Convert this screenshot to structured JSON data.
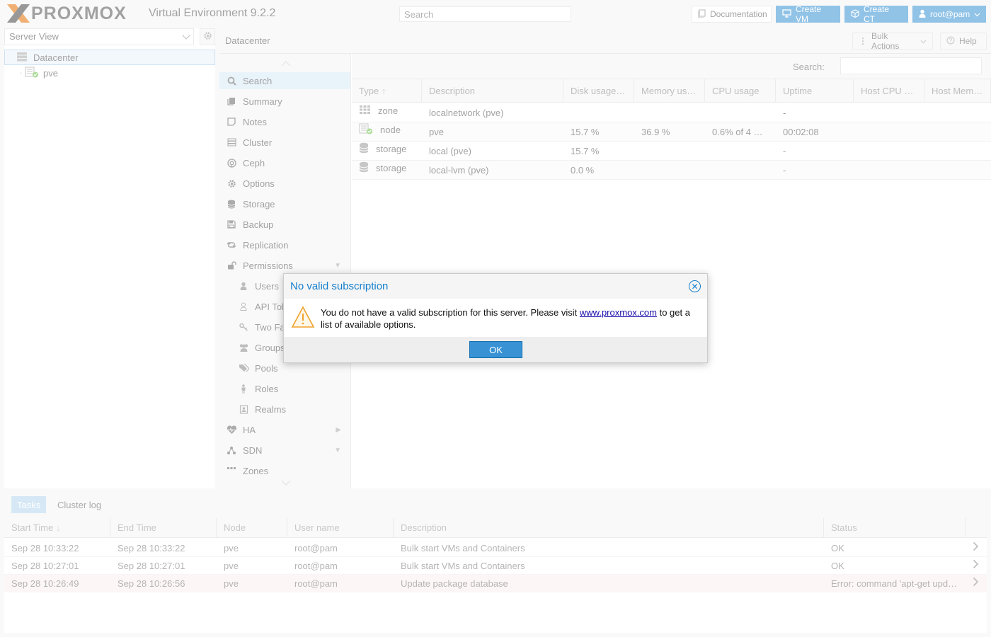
{
  "topbar": {
    "logo_text": "PROXMOX",
    "version": "Virtual Environment 9.2.2",
    "search_placeholder": "Search",
    "documentation": "Documentation",
    "create_vm": "Create VM",
    "create_ct": "Create CT",
    "user": "root@pam"
  },
  "left": {
    "view_selector": "Server View",
    "tree": [
      {
        "label": "Datacenter",
        "icon": "datacenter-icon"
      },
      {
        "label": "pve",
        "icon": "node-ok-icon"
      }
    ]
  },
  "main": {
    "title": "Datacenter",
    "bulk_actions": "Bulk Actions",
    "help": "Help",
    "nav": [
      {
        "label": "Search",
        "icon": "search-icon",
        "active": true
      },
      {
        "label": "Summary",
        "icon": "book-icon"
      },
      {
        "label": "Notes",
        "icon": "notes-icon"
      },
      {
        "label": "Cluster",
        "icon": "server-icon"
      },
      {
        "label": "Ceph",
        "icon": "ceph-icon"
      },
      {
        "label": "Options",
        "icon": "gear-icon"
      },
      {
        "label": "Storage",
        "icon": "database-icon"
      },
      {
        "label": "Backup",
        "icon": "floppy-icon"
      },
      {
        "label": "Replication",
        "icon": "retweet-icon"
      },
      {
        "label": "Permissions",
        "icon": "unlock-icon"
      },
      {
        "label": "Users",
        "icon": "user-icon"
      },
      {
        "label": "API Tok",
        "icon": "user-outline-icon"
      },
      {
        "label": "Two Fa",
        "icon": "key-icon"
      },
      {
        "label": "Groups",
        "icon": "users-icon"
      },
      {
        "label": "Pools",
        "icon": "tags-icon"
      },
      {
        "label": "Roles",
        "icon": "male-icon"
      },
      {
        "label": "Realms",
        "icon": "address-book-icon"
      },
      {
        "label": "HA",
        "icon": "heartbeat-icon"
      },
      {
        "label": "SDN",
        "icon": "sdn-icon"
      },
      {
        "label": "Zones",
        "icon": "zones-icon"
      }
    ],
    "search_label": "Search:",
    "grid_headers": [
      "Type",
      "Description",
      "Disk usage…",
      "Memory us…",
      "CPU usage",
      "Uptime",
      "Host CPU …",
      "Host Mem…"
    ],
    "grid_rows": [
      {
        "type": "zone",
        "description": "localnetwork (pve)",
        "disk": "",
        "memory": "",
        "cpu": "",
        "uptime": "-"
      },
      {
        "type": "node",
        "description": "pve",
        "disk": "15.7 %",
        "memory": "36.9 %",
        "cpu": "0.6% of 4 …",
        "uptime": "00:02:08"
      },
      {
        "type": "storage",
        "description": "local (pve)",
        "disk": "15.7 %",
        "memory": "",
        "cpu": "",
        "uptime": "-"
      },
      {
        "type": "storage",
        "description": "local-lvm (pve)",
        "disk": "0.0 %",
        "memory": "",
        "cpu": "",
        "uptime": "-"
      }
    ]
  },
  "tasks": {
    "tab_tasks": "Tasks",
    "tab_cluster_log": "Cluster log",
    "headers": [
      "Start Time",
      "End Time",
      "Node",
      "User name",
      "Description",
      "Status"
    ],
    "rows": [
      {
        "start": "Sep 28 10:33:22",
        "end": "Sep 28 10:33:22",
        "node": "pve",
        "user": "root@pam",
        "desc": "Bulk start VMs and Containers",
        "status": "OK"
      },
      {
        "start": "Sep 28 10:27:01",
        "end": "Sep 28 10:27:01",
        "node": "pve",
        "user": "root@pam",
        "desc": "Bulk start VMs and Containers",
        "status": "OK"
      },
      {
        "start": "Sep 28 10:26:49",
        "end": "Sep 28 10:26:56",
        "node": "pve",
        "user": "root@pam",
        "desc": "Update package database",
        "status": "Error: command 'apt-get upd…"
      }
    ]
  },
  "modal": {
    "title": "No valid subscription",
    "text_before": "You do not have a valid subscription for this server. Please visit ",
    "link": "www.proxmox.com",
    "text_after": " to get a list of available options.",
    "ok": "OK"
  },
  "colors": {
    "accent": "#3892d4",
    "brand_orange": "#e57000",
    "title_blue": "#157fcc",
    "error_row": "#fcefef"
  }
}
